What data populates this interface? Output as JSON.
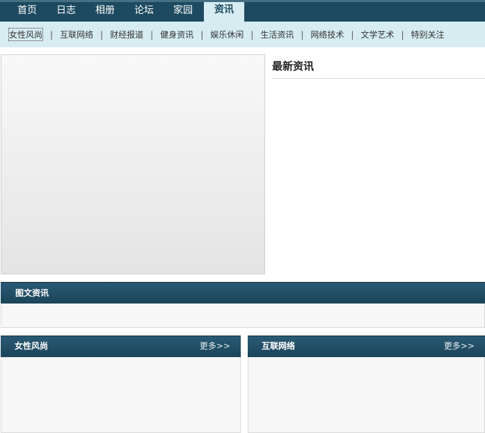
{
  "topnav": {
    "tabs": [
      "首页",
      "日志",
      "相册",
      "论坛",
      "家园"
    ],
    "active_tab": "资讯"
  },
  "subnav": {
    "items": [
      "女性风尚",
      "互联网络",
      "财经报道",
      "健身资讯",
      "娱乐休闲",
      "生活资讯",
      "网络技术",
      "文学艺术",
      "特别关注"
    ],
    "separator": "|"
  },
  "latest": {
    "title": "最新资讯"
  },
  "picnews": {
    "title": "图文资讯"
  },
  "boxes": [
    {
      "title": "女性风尚",
      "more": "更多>>"
    },
    {
      "title": "互联网络",
      "more": "更多>>"
    }
  ]
}
